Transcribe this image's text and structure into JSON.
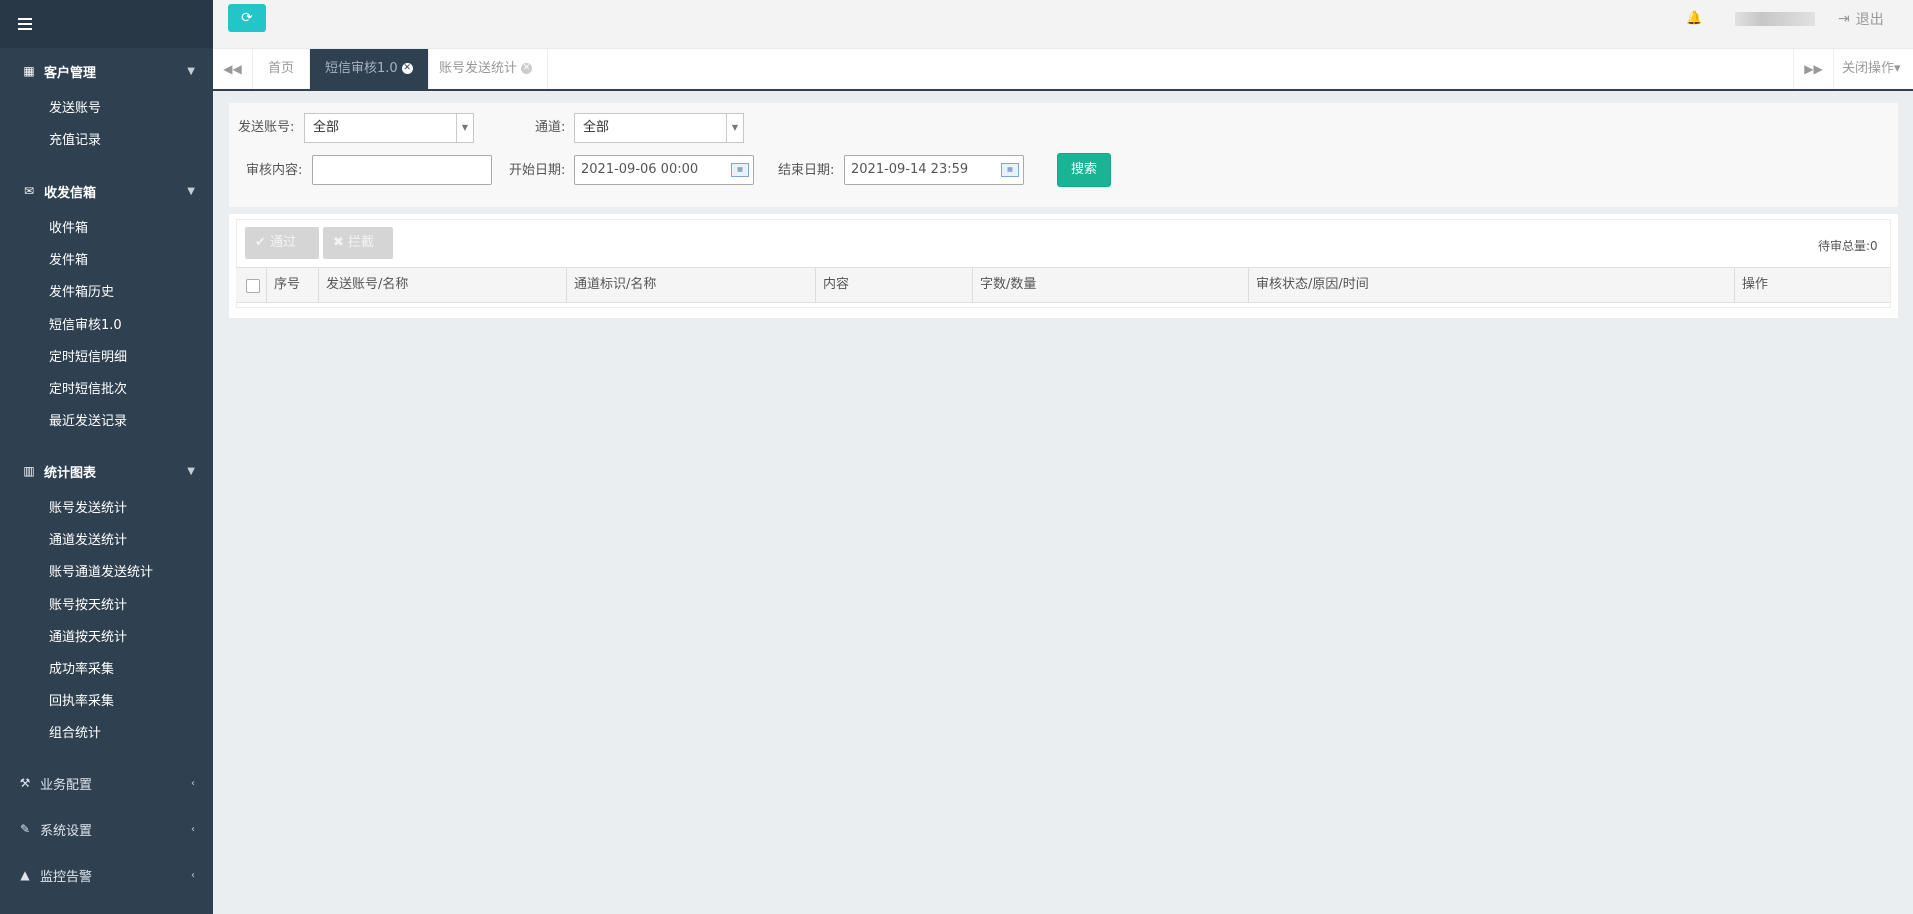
{
  "sidebar": {
    "groups": [
      {
        "label": "客户管理",
        "icon": "table-icon",
        "items": [
          "发送账号",
          "充值记录"
        ]
      },
      {
        "label": "收发信箱",
        "icon": "envelope-icon",
        "items": [
          "收件箱",
          "发件箱",
          "发件箱历史",
          "短信审核1.0",
          "定时短信明细",
          "定时短信批次",
          "最近发送记录"
        ]
      },
      {
        "label": "统计图表",
        "icon": "bar-chart-icon",
        "items": [
          "账号发送统计",
          "通道发送统计",
          "账号通道发送统计",
          "账号按天统计",
          "通道按天统计",
          "成功率采集",
          "回执率采集",
          "组合统计"
        ]
      }
    ],
    "collapsed": [
      {
        "label": "业务配置",
        "icon": "magic-wand-icon"
      },
      {
        "label": "系统设置",
        "icon": "edit-icon"
      },
      {
        "label": "监控告警",
        "icon": "warning-icon"
      }
    ]
  },
  "topbar": {
    "logout": "退出"
  },
  "tabs": {
    "items": [
      {
        "label": "首页"
      },
      {
        "label": "短信审核1.0"
      },
      {
        "label": "账号发送统计"
      }
    ],
    "close_ops": "关闭操作"
  },
  "filter": {
    "account_label": "发送账号:",
    "account_value": "全部",
    "channel_label": "通道:",
    "channel_value": "全部",
    "content_label": "审核内容:",
    "content_value": "",
    "start_label": "开始日期:",
    "start_value": "2021-09-06 00:00",
    "end_label": "结束日期:",
    "end_value": "2021-09-14 23:59",
    "search_label": "搜索"
  },
  "table": {
    "approve_label": "通过",
    "block_label": "拦截",
    "pending_label": "待审总量:0",
    "columns": [
      "序号",
      "发送账号/名称",
      "通道标识/名称",
      "内容",
      "字数/数量",
      "审核状态/原因/时间",
      "操作"
    ]
  }
}
